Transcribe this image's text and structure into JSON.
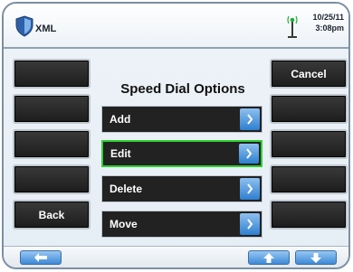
{
  "header": {
    "app_title": "XML",
    "date": "10/25/11",
    "time": "3:08pm",
    "icons": {
      "app": "shield-icon",
      "signal": "antenna-icon"
    }
  },
  "left_softkeys": [
    "",
    "",
    "",
    "",
    "Back"
  ],
  "right_softkeys": [
    "Cancel",
    "",
    "",
    "",
    ""
  ],
  "menu": {
    "title": "Speed Dial Options",
    "items": [
      {
        "label": "Add",
        "selected": false
      },
      {
        "label": "Edit",
        "selected": true
      },
      {
        "label": "Delete",
        "selected": false
      },
      {
        "label": "Move",
        "selected": false
      }
    ]
  },
  "footer": {
    "buttons": [
      "back-arrow-icon",
      "up-arrow-icon",
      "down-arrow-icon"
    ]
  },
  "colors": {
    "accent_blue": "#2d7fd0",
    "selection_green": "#2fd12f",
    "softkey_dark": "#222222"
  }
}
